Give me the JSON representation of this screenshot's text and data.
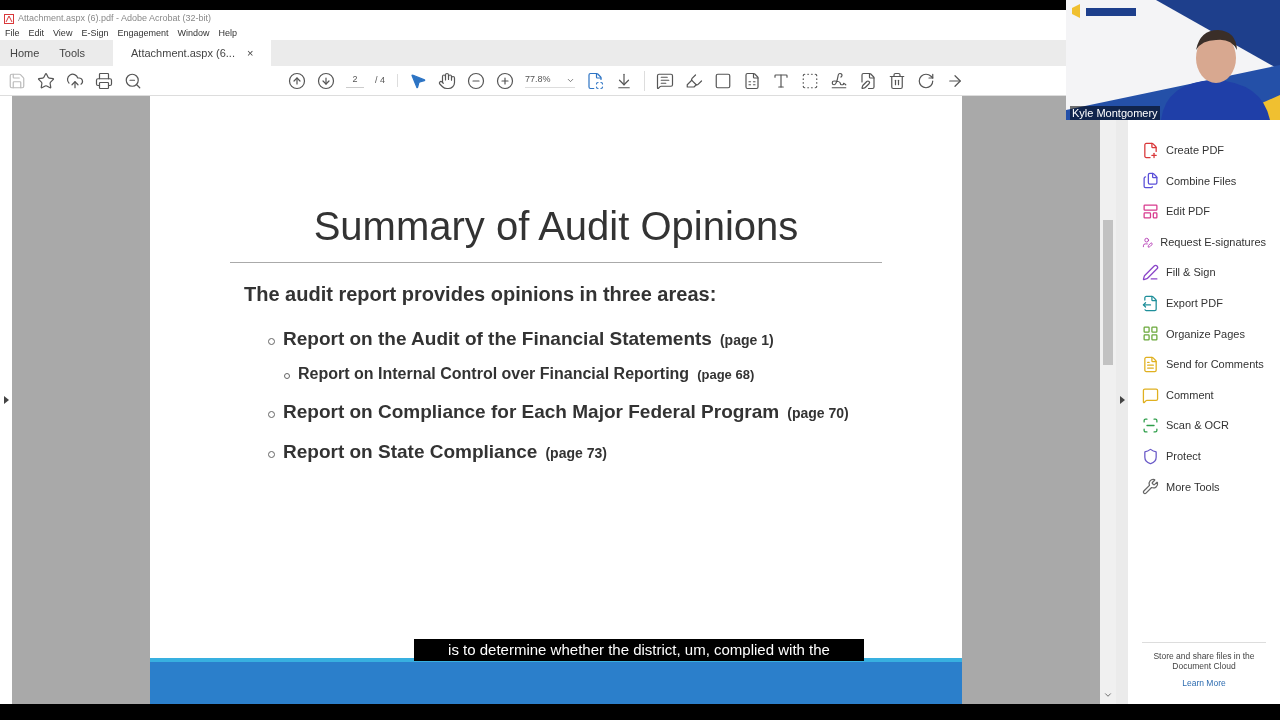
{
  "window": {
    "title": "Attachment.aspx (6).pdf - Adobe Acrobat (32-bit)"
  },
  "menu": [
    "File",
    "Edit",
    "View",
    "E-Sign",
    "Engagement",
    "Window",
    "Help"
  ],
  "tabs": [
    {
      "label": "Home",
      "selected": false
    },
    {
      "label": "Tools",
      "selected": false
    },
    {
      "label": "Attachment.aspx (6...",
      "selected": true,
      "close": "×"
    }
  ],
  "toolbar": {
    "page_current": "2",
    "page_total": "/ 4",
    "zoom": "77.8%"
  },
  "slide": {
    "title": "Summary of Audit Opinions",
    "intro": "The audit report provides opinions in three areas:",
    "items": [
      {
        "text": "Report on the Audit of the Financial Statements",
        "page": "(page 1)",
        "children": [
          {
            "text": "Report on Internal Control over Financial Reporting",
            "page": "(page 68)"
          }
        ]
      },
      {
        "text": "Report on Compliance for Each Major Federal Program",
        "page": "(page 70)"
      },
      {
        "text": "Report on State Compliance",
        "page": "(page 73)"
      }
    ]
  },
  "caption": "is to determine whether the district, um, complied with the",
  "tools_pane": {
    "items": [
      "Create PDF",
      "Combine Files",
      "Edit PDF",
      "Request E-signatures",
      "Fill & Sign",
      "Export PDF",
      "Organize Pages",
      "Send for Comments",
      "Comment",
      "Scan & OCR",
      "Protect",
      "More Tools"
    ],
    "promo": "Store and share files in the Document Cloud",
    "link": "Learn More"
  },
  "video": {
    "name": "Kyle Montgomery"
  }
}
